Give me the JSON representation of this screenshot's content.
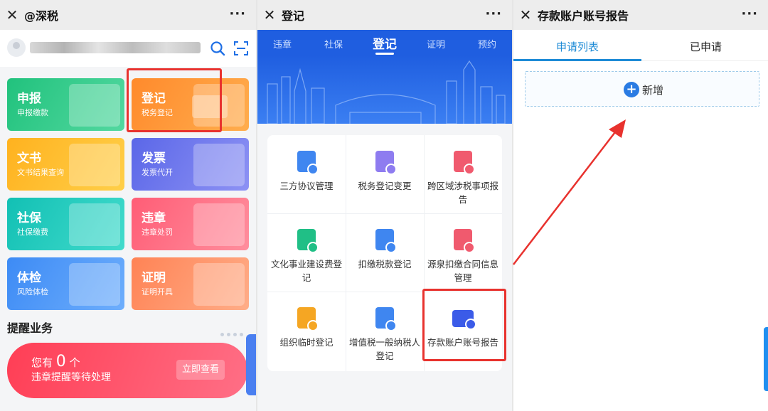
{
  "screen1": {
    "title": "@深税",
    "more": "···",
    "tiles": [
      {
        "title": "申报",
        "sub": "申报缴款"
      },
      {
        "title": "登记",
        "sub": "税务登记"
      },
      {
        "title": "文书",
        "sub": "文书结果查询"
      },
      {
        "title": "发票",
        "sub": "发票代开"
      },
      {
        "title": "社保",
        "sub": "社保缴费"
      },
      {
        "title": "违章",
        "sub": "违章处罚"
      },
      {
        "title": "体检",
        "sub": "风险体检"
      },
      {
        "title": "证明",
        "sub": "证明开具"
      }
    ],
    "remind": {
      "section_title": "提醒业务",
      "prefix": "您有",
      "count": "0",
      "suffix": "个",
      "text": "违章提醒等待处理",
      "button": "立即查看"
    }
  },
  "screen2": {
    "title": "登记",
    "more": "···",
    "tabs": [
      "违章",
      "社保",
      "登记",
      "证明",
      "预约"
    ],
    "items": [
      "三方协议管理",
      "税务登记变更",
      "跨区域涉税事项报告",
      "文化事业建设费登记",
      "扣缴税款登记",
      "源泉扣缴合同信息管理",
      "组织临时登记",
      "增值税一般纳税人登记",
      "存款账户账号报告"
    ]
  },
  "screen3": {
    "title": "存款账户账号报告",
    "more": "···",
    "tabs": [
      "申请列表",
      "已申请"
    ],
    "add_label": "新增"
  },
  "colors": {
    "highlight": "#e8322e",
    "primary_blue": "#1f5ee0",
    "link_blue": "#1e8bd6"
  }
}
